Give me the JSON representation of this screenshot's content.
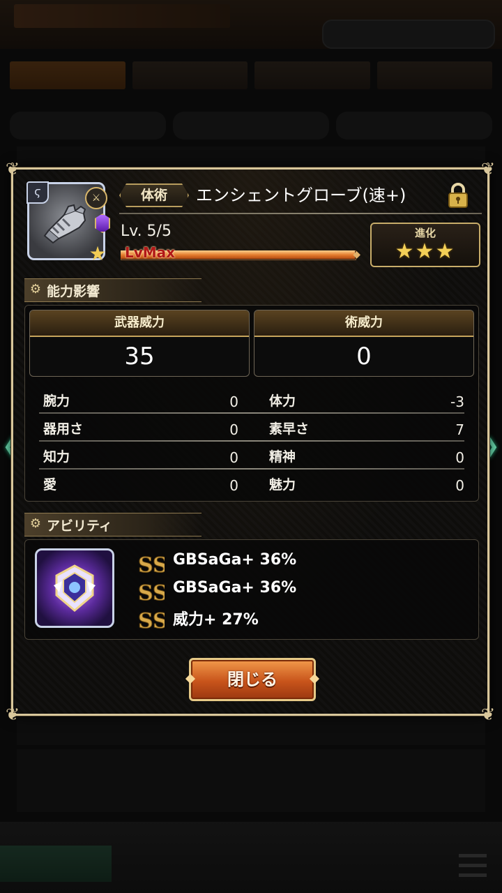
{
  "item": {
    "type_tag": "体術",
    "name": "エンシェントグローブ(速+)",
    "level": "Lv. 5/5",
    "level_bar_text": "LvMax",
    "level_progress": 1.0,
    "evolution_label": "進化",
    "evolution_stars": 3,
    "evolution_stars_display": "★★★",
    "icons": {
      "weapon_type": "fist-icon",
      "lock": "lock-icon",
      "rank": "star-icon"
    }
  },
  "ability_effects": {
    "section_title": "能力影響",
    "weapon_power": {
      "label": "武器威力",
      "value": "35"
    },
    "magic_power": {
      "label": "術威力",
      "value": "0"
    },
    "stats_left": [
      {
        "label": "腕力",
        "value": "0"
      },
      {
        "label": "器用さ",
        "value": "0"
      },
      {
        "label": "知力",
        "value": "0"
      },
      {
        "label": "愛",
        "value": "0"
      }
    ],
    "stats_right": [
      {
        "label": "体力",
        "value": "-3"
      },
      {
        "label": "素早さ",
        "value": "7"
      },
      {
        "label": "精神",
        "value": "0"
      },
      {
        "label": "魅力",
        "value": "0"
      }
    ]
  },
  "abilities": {
    "section_title": "アビリティ",
    "items": [
      {
        "text": "GBSaGa+ 36%"
      },
      {
        "text": "GBSaGa+ 36%"
      },
      {
        "text": "威力+ 27%"
      }
    ]
  },
  "buttons": {
    "close_label": "閉じる"
  },
  "colors": {
    "frame": "#d9c79b",
    "accent_gold": "#c7a55c",
    "button_orange": "#c8541b",
    "nav_arrow": "#6fe6b8"
  }
}
